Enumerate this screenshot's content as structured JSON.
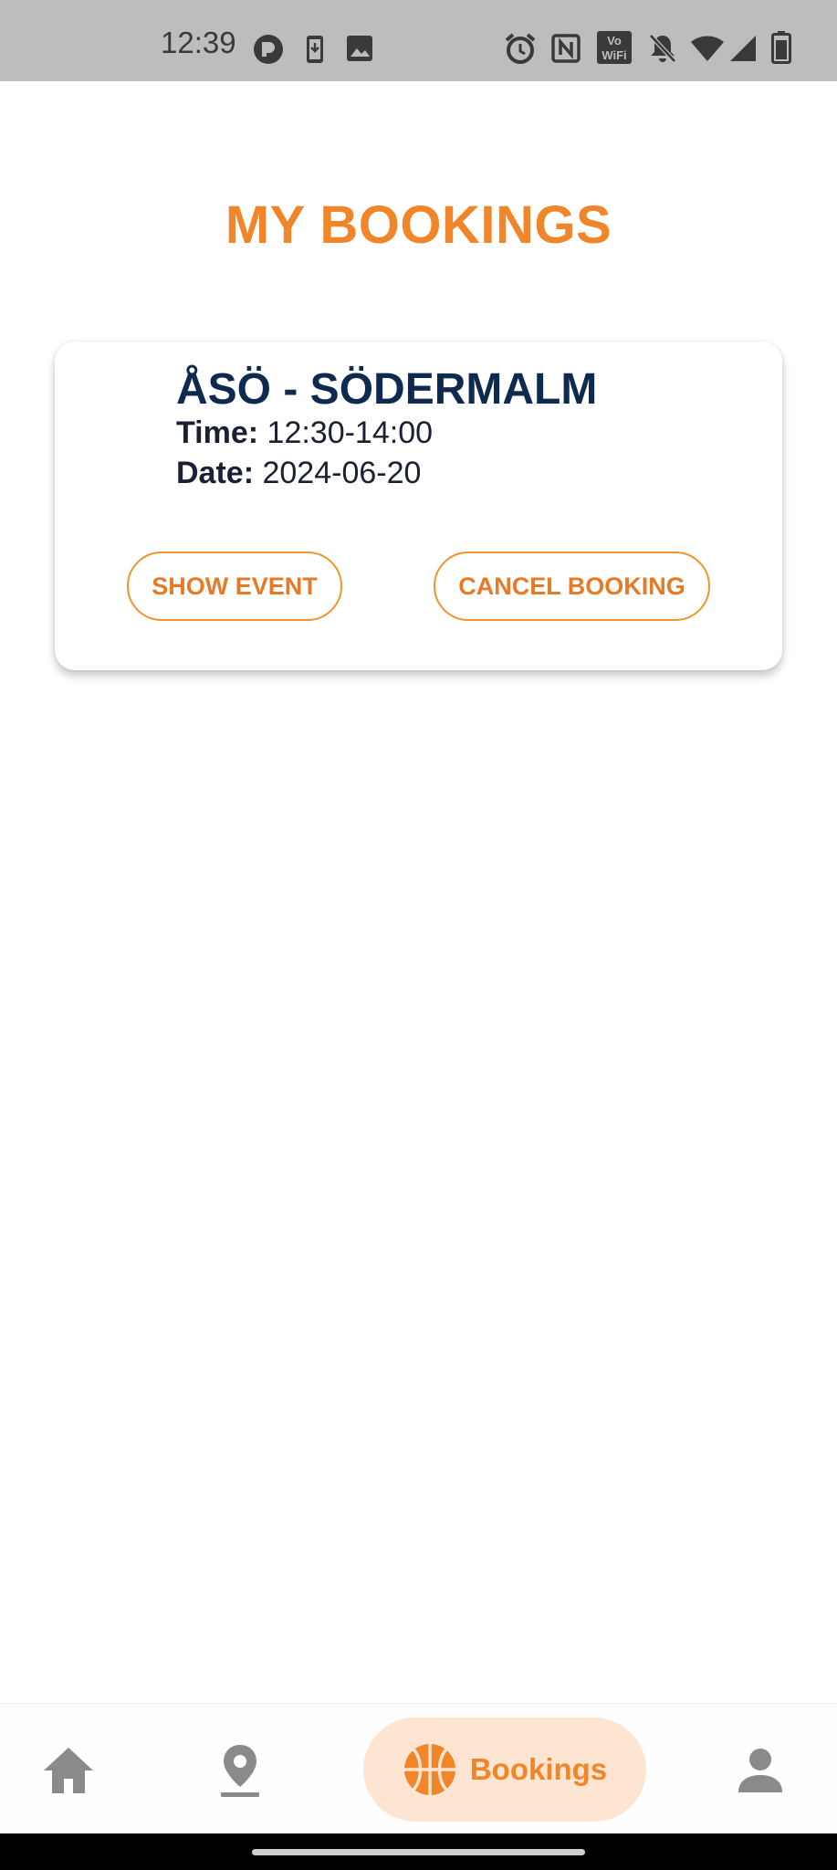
{
  "status_bar": {
    "time": "12:39",
    "left_icons": [
      "app-notification-icon",
      "phone-download-icon",
      "image-icon"
    ],
    "right_icons": [
      "alarm-icon",
      "nfc-icon",
      "vowifi-icon",
      "bell-off-icon",
      "wifi-icon",
      "signal-icon",
      "battery-icon"
    ],
    "vowifi_text": [
      "Vo",
      "WiFi"
    ]
  },
  "page": {
    "title": "MY BOOKINGS"
  },
  "booking": {
    "event_name": "ÅSÖ - SÖDERMALM",
    "time_label": "Time:",
    "time_value": "12:30-14:00",
    "date_label": "Date:",
    "date_value": "2024-06-20",
    "show_event_label": "SHOW EVENT",
    "cancel_label": "CANCEL BOOKING"
  },
  "nav": {
    "items": [
      {
        "icon": "home-icon",
        "label": "",
        "active": false
      },
      {
        "icon": "map-pin-icon",
        "label": "",
        "active": false
      },
      {
        "icon": "basketball-icon",
        "label": "Bookings",
        "active": true
      },
      {
        "icon": "person-icon",
        "label": "",
        "active": false
      }
    ]
  },
  "colors": {
    "accent": "#f0852a",
    "active_nav_bg": "#fde5d2",
    "heading_navy": "#0e2a4f",
    "inactive_icon": "#8a8a8a",
    "status_bar_bg": "#bdbdbd"
  }
}
